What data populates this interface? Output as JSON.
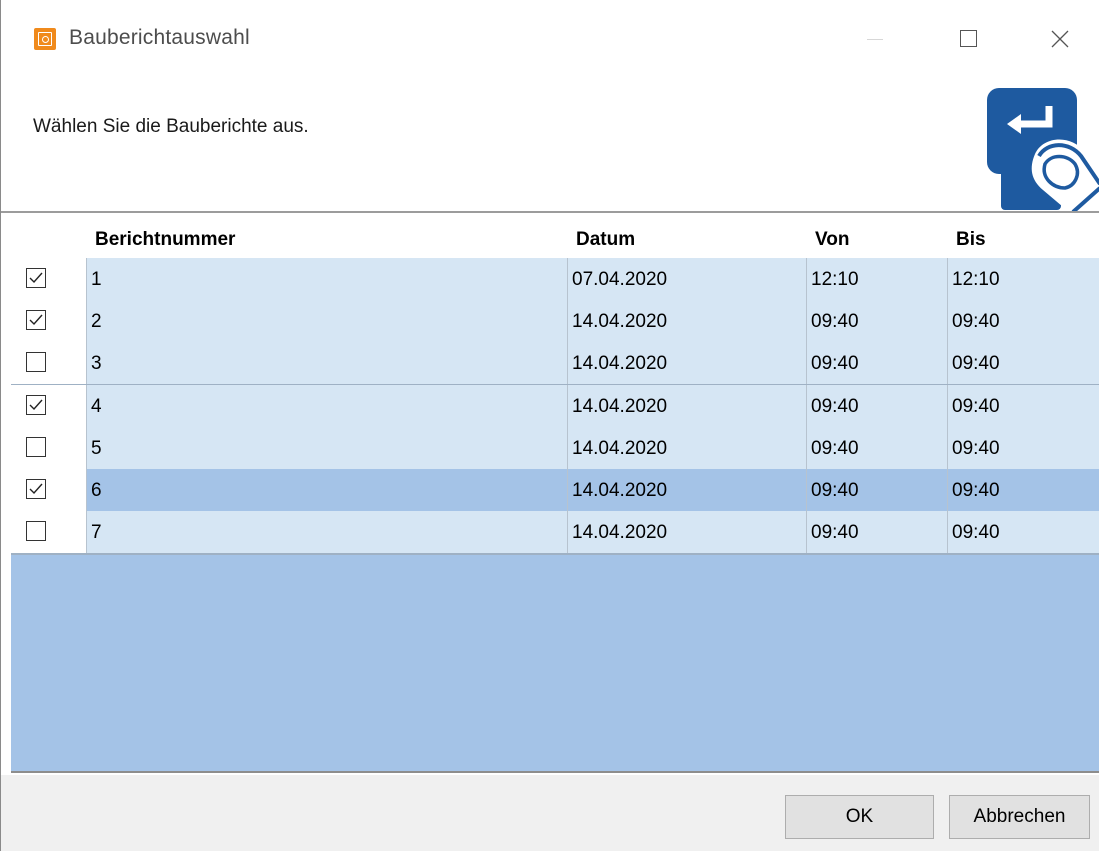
{
  "window": {
    "title": "Bauberichtauswahl",
    "icon": "app-logo-icon",
    "controls": [
      "minimize-icon",
      "maximize-icon",
      "close-icon"
    ]
  },
  "header": {
    "instruction": "Wählen Sie die Bauberichte aus.",
    "graphic": "enter-key-touch-icon"
  },
  "table": {
    "columns": [
      "",
      "Berichtnummer",
      "Datum",
      "Von",
      "Bis"
    ],
    "rows": [
      {
        "checked": true,
        "nummer": "1",
        "datum": "07.04.2020",
        "von": "12:10",
        "bis": "12:10"
      },
      {
        "checked": true,
        "nummer": "2",
        "datum": "14.04.2020",
        "von": "09:40",
        "bis": "09:40"
      },
      {
        "checked": false,
        "nummer": "3",
        "datum": "14.04.2020",
        "von": "09:40",
        "bis": "09:40"
      },
      {
        "checked": true,
        "nummer": "4",
        "datum": "14.04.2020",
        "von": "09:40",
        "bis": "09:40"
      },
      {
        "checked": false,
        "nummer": "5",
        "datum": "14.04.2020",
        "von": "09:40",
        "bis": "09:40"
      },
      {
        "checked": true,
        "nummer": "6",
        "datum": "14.04.2020",
        "von": "09:40",
        "bis": "09:40",
        "selected": true
      },
      {
        "checked": false,
        "nummer": "7",
        "datum": "14.04.2020",
        "von": "09:40",
        "bis": "09:40"
      }
    ]
  },
  "footer": {
    "ok_label": "OK",
    "cancel_label": "Abbrechen"
  },
  "colors": {
    "row_background": "#d6e6f4",
    "selection": "#a4c3e7",
    "app_icon": "#f08a1c",
    "graphic_blue": "#1e5aa0"
  }
}
